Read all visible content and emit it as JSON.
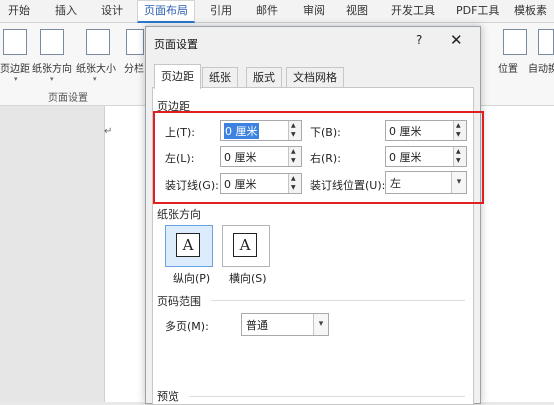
{
  "ribbon_tabs": [
    "开始",
    "插入",
    "设计",
    "页面布局",
    "引用",
    "邮件",
    "审阅",
    "视图",
    "开发工具",
    "PDF工具",
    "模板素"
  ],
  "active_ribbon_tab": "页面布局",
  "ribbon": {
    "buttons": [
      "页边距",
      "纸张方向",
      "纸张大小",
      "分栏"
    ],
    "group_label": "页面设置",
    "right_buttons": [
      "位置",
      "自动换"
    ]
  },
  "document": {
    "paragraph_mark": "↵"
  },
  "dialog": {
    "title": "页面设置",
    "help": "?",
    "close": "✕",
    "tabs": [
      "页边距",
      "纸张",
      "版式",
      "文档网格"
    ],
    "active_tab": "页边距",
    "margins": {
      "section_label": "页边距",
      "top_label": "上(T):",
      "top_value": "0 厘米",
      "bottom_label": "下(B):",
      "bottom_value": "0 厘米",
      "left_label": "左(L):",
      "left_value": "0 厘米",
      "right_label": "右(R):",
      "right_value": "0 厘米",
      "gutter_label": "装订线(G):",
      "gutter_value": "0 厘米",
      "gutter_pos_label": "装订线位置(U):",
      "gutter_pos_value": "左"
    },
    "orientation": {
      "section_label": "纸张方向",
      "portrait_label": "纵向(P)",
      "landscape_label": "横向(S)",
      "glyph": "A",
      "selected": "portrait"
    },
    "pages": {
      "section_label": "页码范围",
      "multi_label": "多页(M):",
      "multi_value": "普通"
    },
    "preview": {
      "section_label": "预览"
    }
  },
  "colors": {
    "highlight_box": "#e02020",
    "active_tab_accent": "#2b78d0",
    "selection": "#3d82e0"
  }
}
